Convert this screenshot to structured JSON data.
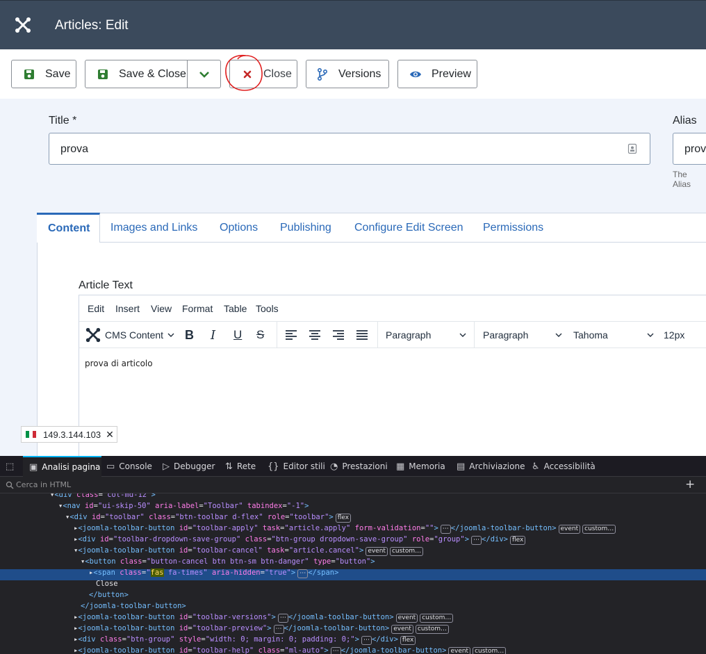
{
  "header": {
    "title": "Articles: Edit"
  },
  "toolbar": {
    "save": "Save",
    "save_close": "Save & Close",
    "close": "Close",
    "versions": "Versions",
    "preview": "Preview"
  },
  "form": {
    "title_label": "Title *",
    "title_value": "prova",
    "alias_label": "Alias",
    "alias_value": "prov",
    "alias_help": "The Alias"
  },
  "tabs": [
    "Content",
    "Images and Links",
    "Options",
    "Publishing",
    "Configure Edit Screen",
    "Permissions"
  ],
  "editor": {
    "label": "Article Text",
    "menu": [
      "Edit",
      "Insert",
      "View",
      "Format",
      "Table",
      "Tools"
    ],
    "cms_content": "CMS Content",
    "block_format_1": "Paragraph",
    "block_format_2": "Paragraph",
    "font_family": "Tahoma",
    "font_size": "12px",
    "content": "prova di articolo"
  },
  "ip_badge": {
    "ip": "149.3.144.103"
  },
  "devtools": {
    "tabs": [
      "Analisi pagina",
      "Console",
      "Debugger",
      "Rete",
      "Editor stili",
      "Prestazioni",
      "Memoria",
      "Archiviazione",
      "Accessibilità"
    ],
    "search_placeholder": "Cerca in HTML",
    "close_text": "Close",
    "chips": {
      "flex": "flex",
      "event": "event",
      "custom": "custom…"
    }
  },
  "colors": {
    "header_bg": "#3b4a5c",
    "accent": "#2a69b8",
    "save_green": "#2f7d32",
    "close_red": "#c52827",
    "annotation": "#e02020"
  }
}
